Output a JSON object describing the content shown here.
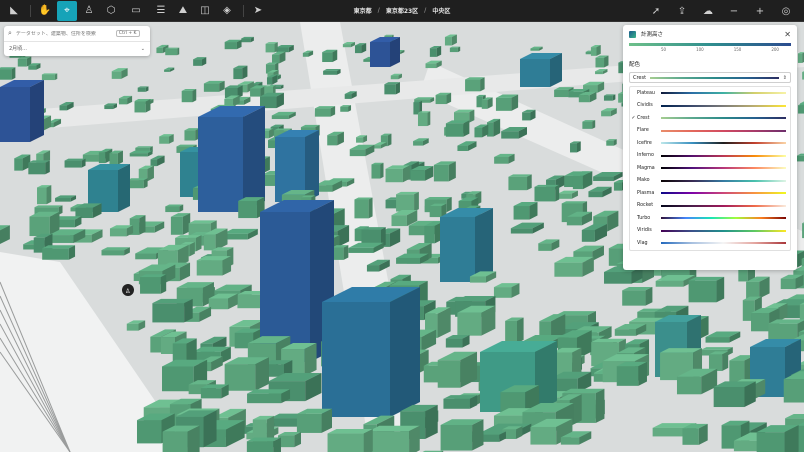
{
  "toolbar": {
    "tools": [
      {
        "name": "logo-icon",
        "glyph": "◣"
      },
      {
        "name": "hand-icon",
        "glyph": "✋"
      },
      {
        "name": "select-icon",
        "glyph": "⌖",
        "active": true
      },
      {
        "name": "pedestrian-icon",
        "glyph": "♙"
      },
      {
        "name": "cube-icon",
        "glyph": "⬡"
      },
      {
        "name": "sketch-icon",
        "glyph": "▭"
      },
      {
        "name": "sliders-icon",
        "glyph": "☰"
      },
      {
        "name": "terrain-icon",
        "glyph": "⛰"
      },
      {
        "name": "split-view-icon",
        "glyph": "◫"
      },
      {
        "name": "layers-icon",
        "glyph": "◈"
      },
      {
        "name": "share-icon",
        "glyph": "➤"
      }
    ],
    "right_tools": [
      {
        "name": "navigate-icon",
        "glyph": "➚"
      },
      {
        "name": "export-icon",
        "glyph": "⇪"
      },
      {
        "name": "cloud-icon",
        "glyph": "☁"
      },
      {
        "name": "minus-icon",
        "glyph": "−"
      },
      {
        "name": "plus-icon",
        "glyph": "+"
      },
      {
        "name": "compass-icon",
        "glyph": "◎"
      }
    ],
    "breadcrumb": [
      "東京都",
      "東京都23区",
      "中央区"
    ]
  },
  "search": {
    "placeholder": "データセット、建築物、住所を検索",
    "shortcut": "Ctrl + K",
    "date": "2月頃..."
  },
  "color_panel": {
    "title": "計測高さ",
    "legend_ticks": [
      "50",
      "100",
      "150",
      "200"
    ],
    "section_label": "配色",
    "selected": "Crest",
    "options": [
      {
        "name": "Plateau",
        "checked": false,
        "colors": [
          "#111a3a",
          "#2c6fa6",
          "#3fb1a4",
          "#d4cf6b",
          "#f7f3a8"
        ]
      },
      {
        "name": "Cividis",
        "checked": false,
        "colors": [
          "#00224e",
          "#3b496c",
          "#7c7b78",
          "#bcaf6f",
          "#fde737"
        ]
      },
      {
        "name": "Crest",
        "checked": true,
        "colors": [
          "#a5cd90",
          "#5ba88f",
          "#2c8a8a",
          "#26618f",
          "#2c2d61"
        ]
      },
      {
        "name": "Flare",
        "checked": false,
        "colors": [
          "#e98d6b",
          "#e3685c",
          "#d14a61",
          "#a83b6a",
          "#6d2f6c"
        ]
      },
      {
        "name": "Icefire",
        "checked": false,
        "colors": [
          "#bde7ea",
          "#3a90c0",
          "#1f1e1e",
          "#c2402e",
          "#fbd5a7"
        ]
      },
      {
        "name": "Inferno",
        "checked": false,
        "colors": [
          "#000004",
          "#56106e",
          "#bb3754",
          "#f98c0a",
          "#fcffa4"
        ]
      },
      {
        "name": "Magma",
        "checked": false,
        "colors": [
          "#000004",
          "#51127c",
          "#b73779",
          "#fc8961",
          "#fcfdbf"
        ]
      },
      {
        "name": "Mako",
        "checked": false,
        "colors": [
          "#0b0405",
          "#382a54",
          "#357ba2",
          "#49c1ad",
          "#def5e5"
        ]
      },
      {
        "name": "Plasma",
        "checked": false,
        "colors": [
          "#0d0887",
          "#7e03a8",
          "#cc4778",
          "#f89540",
          "#f0f921"
        ]
      },
      {
        "name": "Rocket",
        "checked": false,
        "colors": [
          "#03051a",
          "#4c1d4b",
          "#a11a5b",
          "#ef6b49",
          "#faebdd"
        ]
      },
      {
        "name": "Turbo",
        "checked": false,
        "colors": [
          "#30123b",
          "#4686fb",
          "#1ae4b6",
          "#a2fc3c",
          "#fb8022",
          "#7a0403"
        ]
      },
      {
        "name": "Viridis",
        "checked": false,
        "colors": [
          "#440154",
          "#3b528b",
          "#21918c",
          "#5ec962",
          "#fde725"
        ]
      },
      {
        "name": "Vlag",
        "checked": false,
        "colors": [
          "#2369bd",
          "#a9c1e0",
          "#f5f5f5",
          "#e4a6a0",
          "#a9373b"
        ]
      }
    ]
  }
}
